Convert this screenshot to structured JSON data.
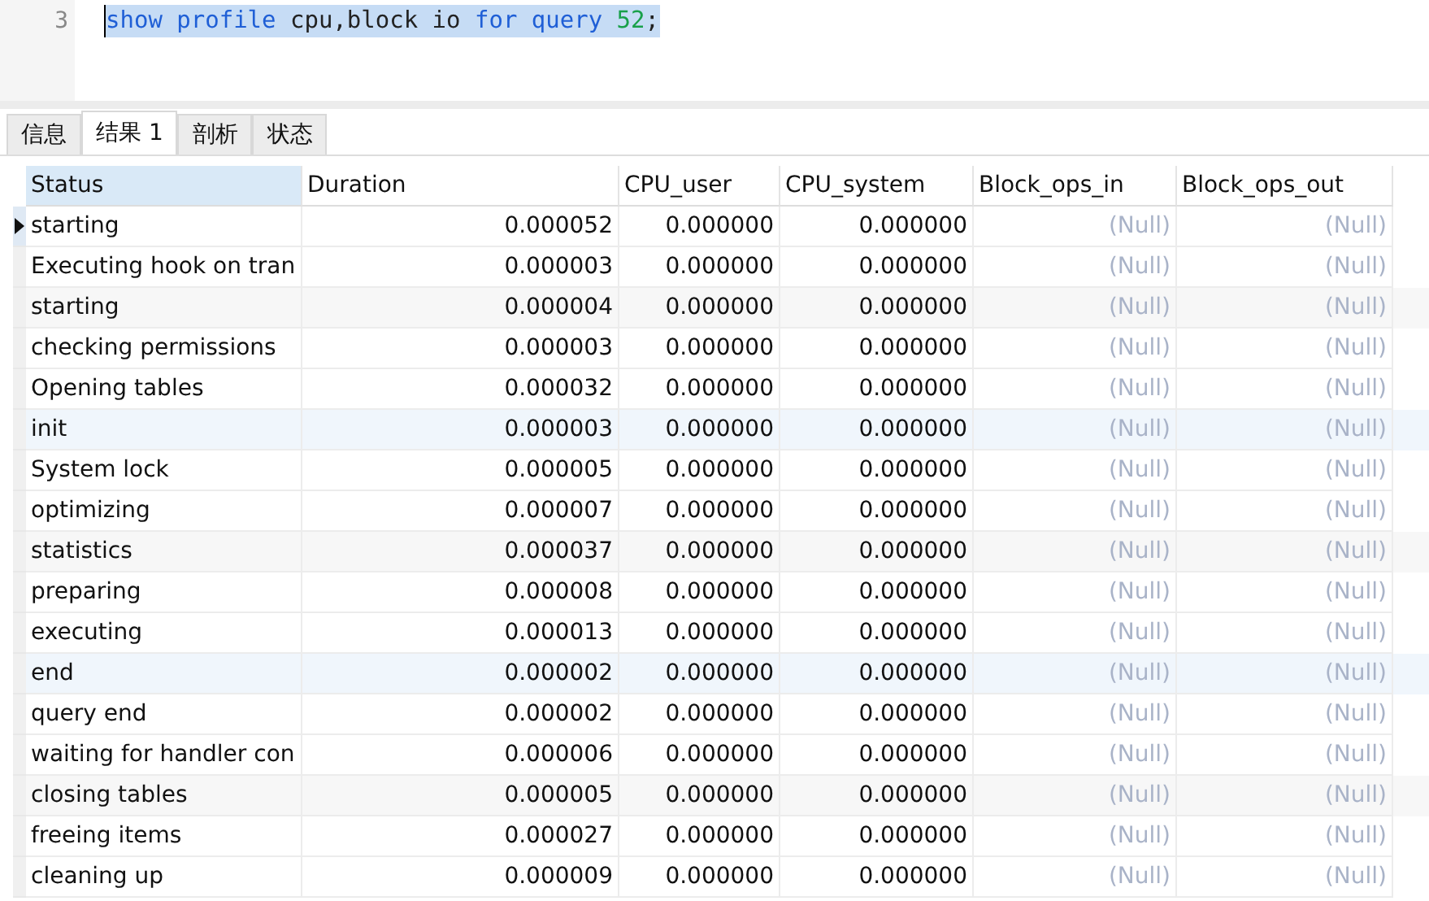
{
  "editor": {
    "lines": [
      {
        "number": "3",
        "selected": true,
        "tokens": [
          {
            "kind": "keyword",
            "text": "show profile"
          },
          {
            "kind": "plain",
            "text": " cpu,block io "
          },
          {
            "kind": "keyword",
            "text": "for query "
          },
          {
            "kind": "number",
            "text": "52"
          },
          {
            "kind": "plain",
            "text": ";"
          }
        ]
      }
    ]
  },
  "tabs": [
    {
      "label": "信息",
      "selected": false
    },
    {
      "label": "结果 1",
      "selected": true
    },
    {
      "label": "剖析",
      "selected": false
    },
    {
      "label": "状态",
      "selected": false
    }
  ],
  "table": {
    "columns": [
      {
        "label": "Status",
        "selected": true
      },
      {
        "label": "Duration",
        "selected": false
      },
      {
        "label": "CPU_user",
        "selected": false
      },
      {
        "label": "CPU_system",
        "selected": false
      },
      {
        "label": "Block_ops_in",
        "selected": false
      },
      {
        "label": "Block_ops_out",
        "selected": false
      }
    ],
    "rows": [
      {
        "selected": true,
        "cells": [
          "starting",
          "0.000052",
          "0.000000",
          "0.000000",
          "(Null)",
          "(Null)"
        ]
      },
      {
        "selected": false,
        "cells": [
          "Executing hook on tran",
          "0.000003",
          "0.000000",
          "0.000000",
          "(Null)",
          "(Null)"
        ]
      },
      {
        "selected": false,
        "cells": [
          "starting",
          "0.000004",
          "0.000000",
          "0.000000",
          "(Null)",
          "(Null)"
        ]
      },
      {
        "selected": false,
        "cells": [
          "checking permissions",
          "0.000003",
          "0.000000",
          "0.000000",
          "(Null)",
          "(Null)"
        ]
      },
      {
        "selected": false,
        "cells": [
          "Opening tables",
          "0.000032",
          "0.000000",
          "0.000000",
          "(Null)",
          "(Null)"
        ]
      },
      {
        "selected": false,
        "cells": [
          "init",
          "0.000003",
          "0.000000",
          "0.000000",
          "(Null)",
          "(Null)"
        ]
      },
      {
        "selected": false,
        "cells": [
          "System lock",
          "0.000005",
          "0.000000",
          "0.000000",
          "(Null)",
          "(Null)"
        ]
      },
      {
        "selected": false,
        "cells": [
          "optimizing",
          "0.000007",
          "0.000000",
          "0.000000",
          "(Null)",
          "(Null)"
        ]
      },
      {
        "selected": false,
        "cells": [
          "statistics",
          "0.000037",
          "0.000000",
          "0.000000",
          "(Null)",
          "(Null)"
        ]
      },
      {
        "selected": false,
        "cells": [
          "preparing",
          "0.000008",
          "0.000000",
          "0.000000",
          "(Null)",
          "(Null)"
        ]
      },
      {
        "selected": false,
        "cells": [
          "executing",
          "0.000013",
          "0.000000",
          "0.000000",
          "(Null)",
          "(Null)"
        ]
      },
      {
        "selected": false,
        "cells": [
          "end",
          "0.000002",
          "0.000000",
          "0.000000",
          "(Null)",
          "(Null)"
        ]
      },
      {
        "selected": false,
        "cells": [
          "query end",
          "0.000002",
          "0.000000",
          "0.000000",
          "(Null)",
          "(Null)"
        ]
      },
      {
        "selected": false,
        "cells": [
          "waiting for handler con",
          "0.000006",
          "0.000000",
          "0.000000",
          "(Null)",
          "(Null)"
        ]
      },
      {
        "selected": false,
        "cells": [
          "closing tables",
          "0.000005",
          "0.000000",
          "0.000000",
          "(Null)",
          "(Null)"
        ]
      },
      {
        "selected": false,
        "cells": [
          "freeing items",
          "0.000027",
          "0.000000",
          "0.000000",
          "(Null)",
          "(Null)"
        ]
      },
      {
        "selected": false,
        "cells": [
          "cleaning up",
          "0.000009",
          "0.000000",
          "0.000000",
          "(Null)",
          "(Null)"
        ]
      }
    ]
  }
}
